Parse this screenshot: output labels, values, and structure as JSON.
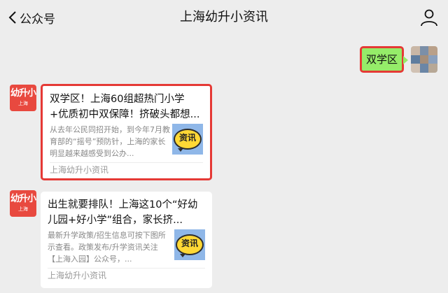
{
  "header": {
    "back_label": "公众号",
    "title": "上海幼升小资讯",
    "back_icon": "chevron-left-icon",
    "profile_icon": "person-icon"
  },
  "outgoing_message": {
    "text": "双学区"
  },
  "account_avatar": {
    "big": "幼升小",
    "small": "上海"
  },
  "articles": [
    {
      "title": "双学区！上海60组超热门小学+优质初中双保障！挤破头都想...",
      "desc": "从去年公民同招开始，到今年7月教育部的“摇号”预防针，上海的家长明显越来越感受到公办...",
      "thumb_text": "资讯",
      "footer": "上海幼升小资讯"
    },
    {
      "title": "出生就要排队！上海这10个“好幼儿园+好小学”组合，家长挤...",
      "desc": "最新升学政策/招生信息可按下图所示查看。政策发布/升学资讯关注【上海入园】公众号，...",
      "thumb_text": "资讯",
      "footer": "上海幼升小资讯"
    }
  ],
  "colors": {
    "background": "#ededed",
    "outgoing_bubble": "#95ec69",
    "highlight_border": "#e53935",
    "avatar_red": "#e8493f",
    "thumb_blue": "#8fb7e8",
    "thumb_yellow": "#ffd835"
  }
}
